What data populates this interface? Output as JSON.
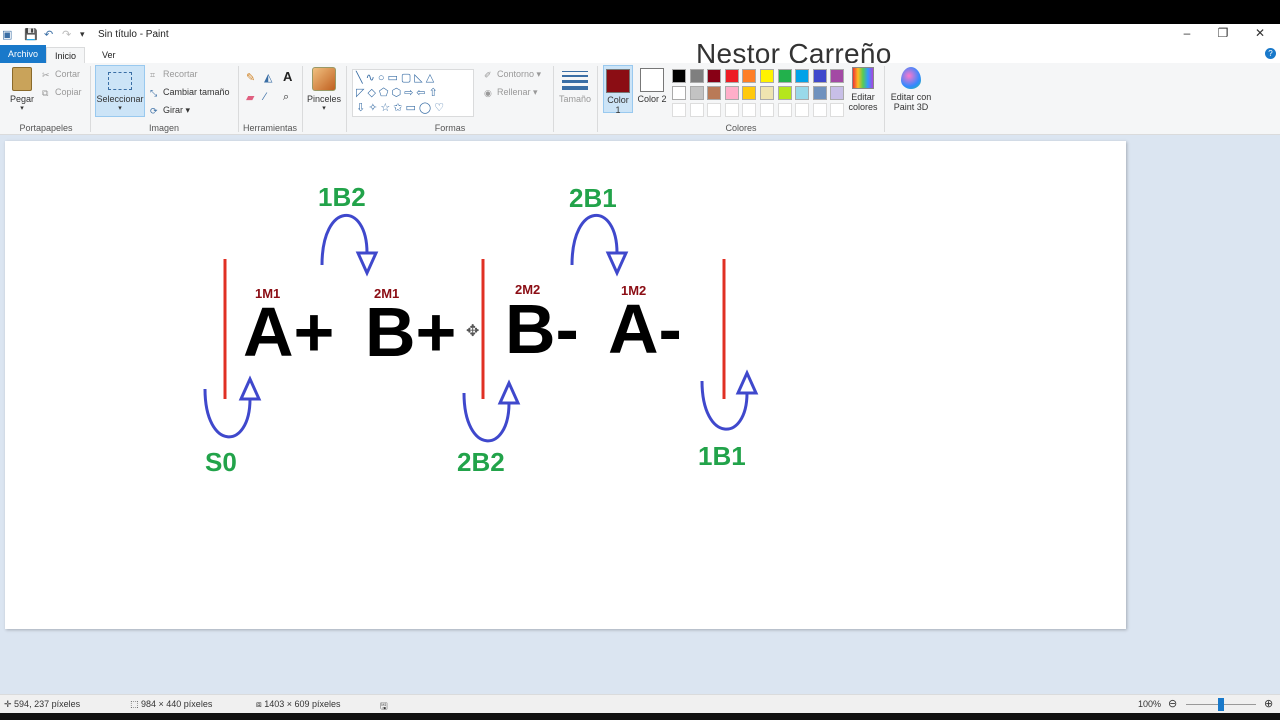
{
  "window": {
    "title": "Sin título - Paint",
    "watermark": "Nestor Carreño"
  },
  "tabs": {
    "file": "Archivo",
    "home": "Inicio",
    "view": "Ver"
  },
  "ribbon": {
    "clipboard": {
      "paste": "Pegar",
      "cut": "Cortar",
      "copy": "Copiar",
      "label": "Portapapeles"
    },
    "image": {
      "select": "Seleccionar",
      "crop": "Recortar",
      "resize": "Cambiar tamaño",
      "rotate": "Girar",
      "label": "Imagen"
    },
    "tools": {
      "label": "Herramientas"
    },
    "brushes": {
      "label": "Pinceles"
    },
    "shapes": {
      "outline": "Contorno",
      "fill": "Rellenar",
      "label": "Formas"
    },
    "size": {
      "label": "Tamaño"
    },
    "colors": {
      "color1": "Color 1",
      "color2": "Color 2",
      "edit": "Editar colores",
      "label": "Colores",
      "color1_value": "#8b0d14",
      "color2_value": "#ffffff",
      "palette_row1": [
        "#000000",
        "#7f7f7f",
        "#880015",
        "#ed1c24",
        "#ff7f27",
        "#fff200",
        "#22b14c",
        "#00a2e8",
        "#3f48cc",
        "#a349a4"
      ],
      "palette_row2": [
        "#ffffff",
        "#c3c3c3",
        "#b97a57",
        "#ffaec9",
        "#ffc90e",
        "#efe4b0",
        "#b5e61d",
        "#99d9ea",
        "#7092be",
        "#c8bfe7"
      ]
    },
    "paint3d": "Editar con Paint 3D"
  },
  "drawing": {
    "sequence": [
      {
        "op": "A+",
        "label": "1M1"
      },
      {
        "op": "B+",
        "label": "2M1"
      },
      {
        "op": "B-",
        "label": "2M2"
      },
      {
        "op": "A-",
        "label": "1M2"
      }
    ],
    "top_signals": [
      "1B2",
      "2B1"
    ],
    "bottom_signals": [
      "S0",
      "2B2",
      "1B1"
    ],
    "colors": {
      "text": "#000000",
      "sublabel": "#8b0d14",
      "signal": "#22a34a",
      "arrow": "#3f48cc",
      "divider": "#e03024"
    }
  },
  "status": {
    "cursor": "594, 237 píxeles",
    "selection": "984 × 440 píxeles",
    "image_size": "1403 × 609 píxeles",
    "zoom": "100%"
  }
}
